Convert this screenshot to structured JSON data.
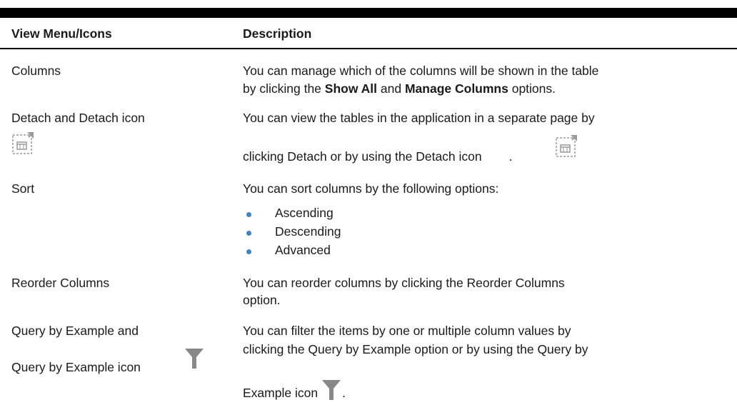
{
  "header": {
    "col1": "View Menu/Icons",
    "col2": "Description"
  },
  "rows": [
    {
      "name": "Columns",
      "desc_line1": "You can manage which of the columns will be shown in the table",
      "desc_pre": "by clicking the ",
      "desc_b1": "Show All",
      "desc_mid": " and ",
      "desc_b2": "Manage Columns",
      "desc_post": " options."
    },
    {
      "name": "Detach and Detach icon",
      "name_icon": "detach-icon",
      "desc_line1": "You can view the tables in the application in a separate page by",
      "desc_line2": "clicking Detach or by using the Detach icon",
      "desc_tail": "."
    },
    {
      "name": "Sort",
      "desc_line1": "You can sort columns by the following options:",
      "options": [
        "Ascending",
        "Descending",
        "Advanced"
      ],
      "bullet_color": "#3d85c6"
    },
    {
      "name": "Reorder Columns",
      "desc_line1": "You can reorder columns by clicking the Reorder Columns",
      "desc_line2": "option."
    },
    {
      "name_line1": "Query by Example and",
      "name_line2": "Query by Example icon",
      "name_icon": "funnel-icon",
      "desc_line1": "You can filter the items by one or multiple column values by",
      "desc_line2": "clicking the Query by Example option or by using the Query by",
      "desc_line3": "Example icon",
      "desc_tail": "."
    }
  ]
}
